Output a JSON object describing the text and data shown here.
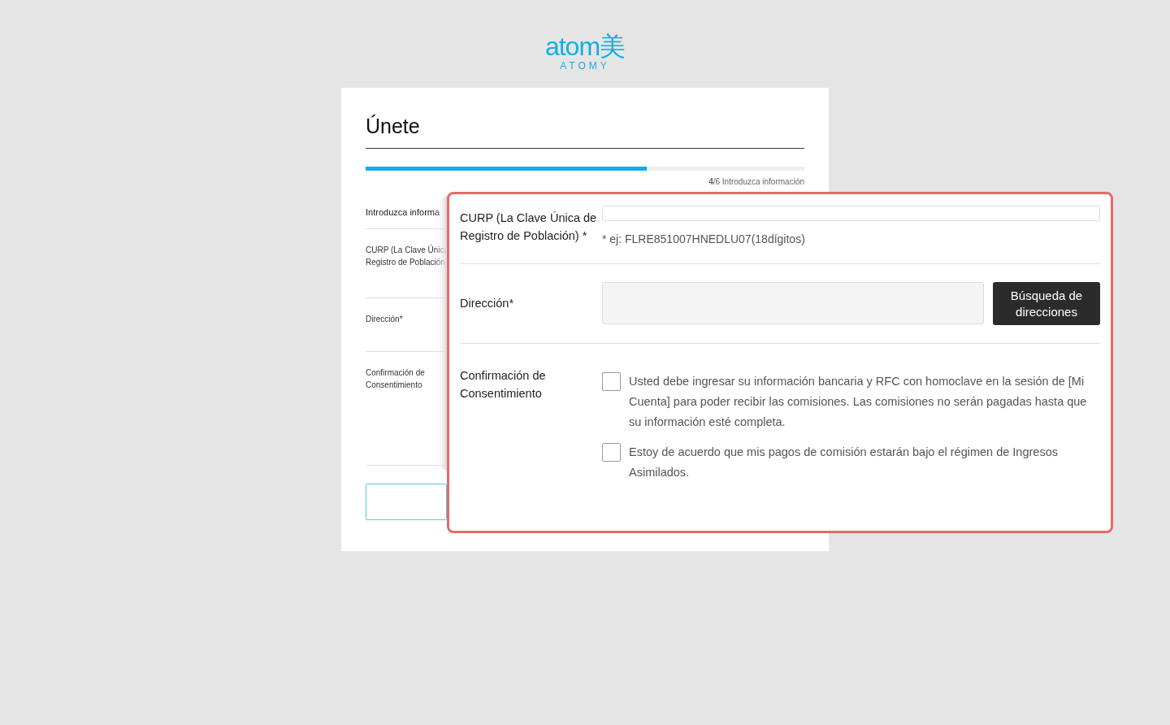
{
  "logo": {
    "mark": "atom美",
    "name": "ATOMY"
  },
  "title": "Únete",
  "progress": {
    "level": 0.64,
    "step": "**4**/6 Introduzca información"
  },
  "background_form": {
    "section": "Introduzca informa",
    "rows": [
      {
        "lines": [
          "CURP (La Clave Única",
          "Registro de Población"
        ]
      },
      {
        "lines": [
          "Dirección*"
        ]
      },
      {
        "lines": [
          "Confirmación de",
          "Consentimiento"
        ]
      }
    ]
  },
  "callout": {
    "fields": [
      {
        "kind": "text",
        "label": "CURP (La Clave Única de Registro de Población) *",
        "hint": "* ej: FLRE851007HNEDLU07(18dígitos)"
      },
      {
        "kind": "address",
        "label": "Dirección*",
        "button": "Búsqueda de direcciones"
      },
      {
        "kind": "consent",
        "label": "Confirmación de Consentimiento",
        "items": [
          {
            "text": "Usted debe ingresar su información bancaria y RFC con homoclave en la sesión de [Mi Cuenta] para poder recibir las comisiones. Las comisiones no serán pagadas hasta que su información esté completa.",
            "checked": false
          },
          {
            "text": "Estoy de acuerdo que mis pagos de comisión estarán bajo el régimen de Ingresos Asimilados.",
            "checked": false
          }
        ]
      }
    ]
  }
}
